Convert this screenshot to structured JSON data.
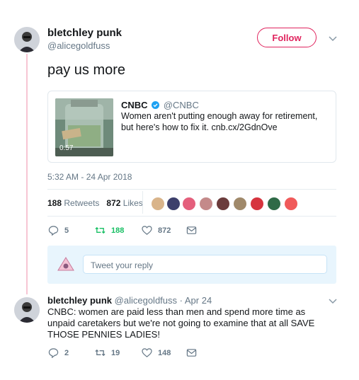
{
  "main_tweet": {
    "author_name": "bletchley punk",
    "author_handle": "@alicegoldfuss",
    "follow_label": "Follow",
    "text": "pay us more",
    "quoted": {
      "name": "CNBC",
      "handle": "@CNBC",
      "text": "Women aren't putting enough away for retirement, but here's how to fix it. cnb.cx/2GdnOve",
      "video_duration": "0:57"
    },
    "timestamp": "5:32 AM - 24 Apr 2018",
    "retweets_count": "188",
    "retweets_label": "Retweets",
    "likes_count": "872",
    "likes_label": "Likes",
    "actions": {
      "reply_count": "5",
      "retweet_count": "188",
      "like_count": "872"
    }
  },
  "reply_composer": {
    "placeholder": "Tweet your reply"
  },
  "reply_tweet": {
    "author_name": "bletchley punk",
    "author_handle": "@alicegoldfuss",
    "date": "Apr 24",
    "separator": "·",
    "text": "CNBC: women are paid less than men and spend more time as unpaid caretakers but we're not going to examine that at all SAVE THOSE PENNIES LADIES!",
    "actions": {
      "reply_count": "2",
      "retweet_count": "19",
      "like_count": "148"
    }
  },
  "colors": {
    "accent_pink": "#e0245e",
    "retweet_green": "#17bf63",
    "thread_line": "#f7c5d4",
    "verified_blue": "#1da1f2"
  }
}
